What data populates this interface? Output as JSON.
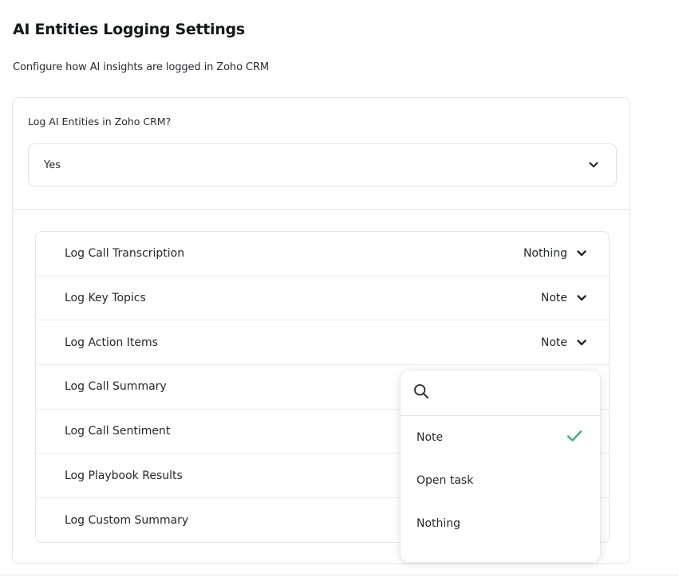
{
  "page": {
    "title": "AI Entities Logging Settings",
    "subtitle": "Configure how AI insights are logged in Zoho CRM"
  },
  "log_toggle": {
    "label": "Log AI Entities in Zoho CRM?",
    "value": "Yes"
  },
  "entities": {
    "rows": [
      {
        "label": "Log Call Transcription",
        "value": "Nothing"
      },
      {
        "label": "Log Key Topics",
        "value": "Note"
      },
      {
        "label": "Log Action Items",
        "value": "Note"
      },
      {
        "label": "Log Call Summary",
        "value": ""
      },
      {
        "label": "Log Call Sentiment",
        "value": ""
      },
      {
        "label": "Log Playbook Results",
        "value": ""
      },
      {
        "label": "Log Custom Summary",
        "value": ""
      }
    ]
  },
  "dropdown": {
    "search_placeholder": "",
    "options": [
      {
        "label": "Note",
        "selected": true
      },
      {
        "label": "Open task",
        "selected": false
      },
      {
        "label": "Nothing",
        "selected": false
      }
    ]
  },
  "icons": {
    "chevron": "chevron-down-icon",
    "search": "search-icon",
    "check": "check-icon"
  },
  "colors": {
    "check": "#3cae7e",
    "border": "#e5e5e8",
    "text": "#26272b"
  }
}
